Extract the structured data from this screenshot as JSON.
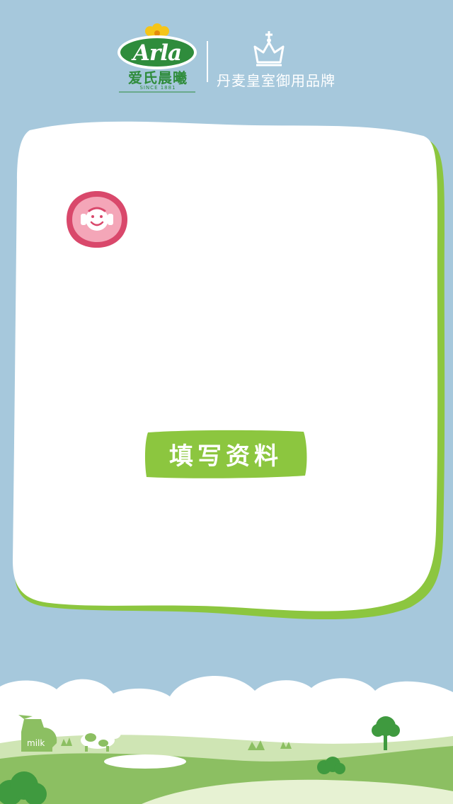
{
  "brand": {
    "logo_wordmark": "Arla",
    "logo_chinese": "爱氏晨曦",
    "logo_since": "SINCE 1881",
    "royal_text": "丹麦皇室御用品牌"
  },
  "profile": {
    "avatar_icon": "avatar-face-icon"
  },
  "actions": {
    "fill_info_label": "填写资料"
  },
  "scene": {
    "milk_jug_label": "milk"
  },
  "colors": {
    "sky": "#a6c8dc",
    "card": "#ffffff",
    "card_border": "#8cc63f",
    "button": "#8cc63f",
    "avatar_ring": "#d9486b",
    "brand_green": "#2f8c3c"
  }
}
